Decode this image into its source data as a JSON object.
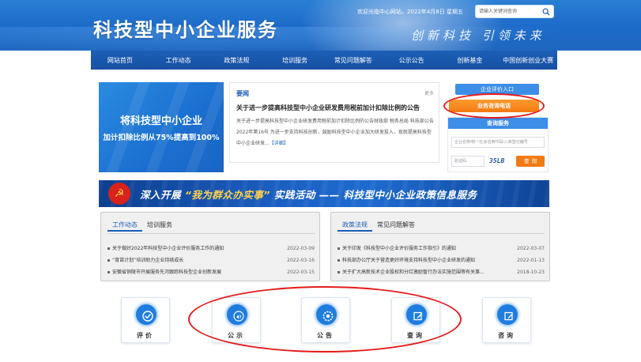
{
  "header": {
    "site_title": "科技型中小企业服务",
    "slogan": "创新科技 引领未来",
    "welcome_text": "欢迎光临中心网站，2022年4月8日 星期五",
    "search_placeholder": "请输入关键词查询",
    "search_icon": "search-icon"
  },
  "nav": {
    "items": [
      "网站首页",
      "工作动态",
      "政策法规",
      "培训服务",
      "常见问题解答",
      "公示公告",
      "创新基金",
      "中国创新创业大赛"
    ]
  },
  "banner": {
    "line1": "将科技型中小企业",
    "line2": "加计扣除比例从75%提高到100%"
  },
  "notice": {
    "label": "要闻",
    "more": "更多",
    "title": "关于进一步提高科技型中小企业研发费用税前加计扣除比例的公告",
    "body": "关于进一步提高科技型中小企业研发费用税前加计扣除比例的公告财政部 税务总局 科技部公告2022年第16号 为进一步支持科技创新，鼓励科技型中小企业加大研发投入，现就提高科技型中小企业研发...",
    "read_more": "【详细】"
  },
  "side": {
    "eval_entry": "企业评价入口",
    "hotline": "业务咨询电话",
    "query_title": "查询服务",
    "query_placeholder": "企业名称/统一社会信用代码/入库登记编号",
    "captcha_placeholder": "验证码",
    "captcha_code": "35LB",
    "query_button": "查 询"
  },
  "campaign": {
    "part1": "深入开展",
    "part2": "“我为群众办实事”",
    "part3": "实践活动 —— 科技型中小企业政策信息服务",
    "emblem": "☭"
  },
  "left_list": {
    "tabs": [
      "工作动态",
      "培训服务"
    ],
    "items": [
      {
        "title": "关于做好2022年科技型中小企业评价服务工作的通知",
        "date": "2022-03-09"
      },
      {
        "title": "“育苗计划”培训助力企业持续成长",
        "date": "2022-03-16"
      },
      {
        "title": "安徽省铜陵市开展服务先河跟踪科技型企业创新发展",
        "date": "2022-03-15"
      }
    ]
  },
  "right_list": {
    "tabs": [
      "政策法规",
      "常见问题解答"
    ],
    "items": [
      {
        "title": "关于印发《科技型中小企业评价服务工作指引》的通知",
        "date": "2022-03-07"
      },
      {
        "title": "科技部办公厅关于营造更好环境支持科技型中小企业研发的通知",
        "date": "2022-01-13"
      },
      {
        "title": "关于扩大高新技术企业股权和分红激励暂行办法实施范围等有关事...",
        "date": "2018-10-23"
      }
    ]
  },
  "services": [
    {
      "label": "评价",
      "icon": "check-icon"
    },
    {
      "label": "公示",
      "icon": "megaphone-icon"
    },
    {
      "label": "公告",
      "icon": "gear-icon"
    },
    {
      "label": "查询",
      "icon": "edit-icon"
    },
    {
      "label": "咨询",
      "icon": "pencil-icon"
    }
  ],
  "colors": {
    "primary": "#1d5fb7",
    "accent_orange": "#f27a12",
    "annotation_red": "#e41b1b"
  }
}
